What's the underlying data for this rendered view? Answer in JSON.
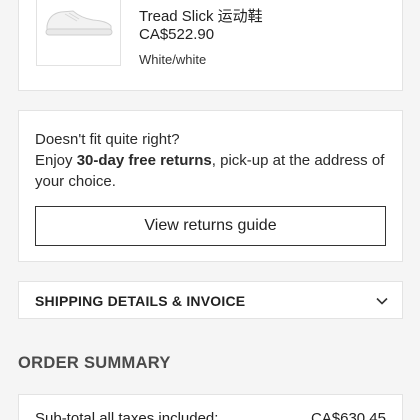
{
  "product": {
    "name": "Tread Slick 运动鞋",
    "price": "CA$522.90",
    "color": "White/white",
    "image_icon": "white-sneaker"
  },
  "returns": {
    "line_intro": "Doesn't fit quite right?",
    "line_prefix": "Enjoy ",
    "line_bold": "30-day free returns",
    "line_suffix": ", pick-up at the address of your choice.",
    "button_label": "View returns guide"
  },
  "shipping": {
    "title": "SHIPPING DETAILS & INVOICE",
    "icon": "chevron-down-icon"
  },
  "summary": {
    "title": "ORDER SUMMARY",
    "subtotal_label": "Sub-total all taxes included:",
    "subtotal_value": "CA$630.45"
  }
}
